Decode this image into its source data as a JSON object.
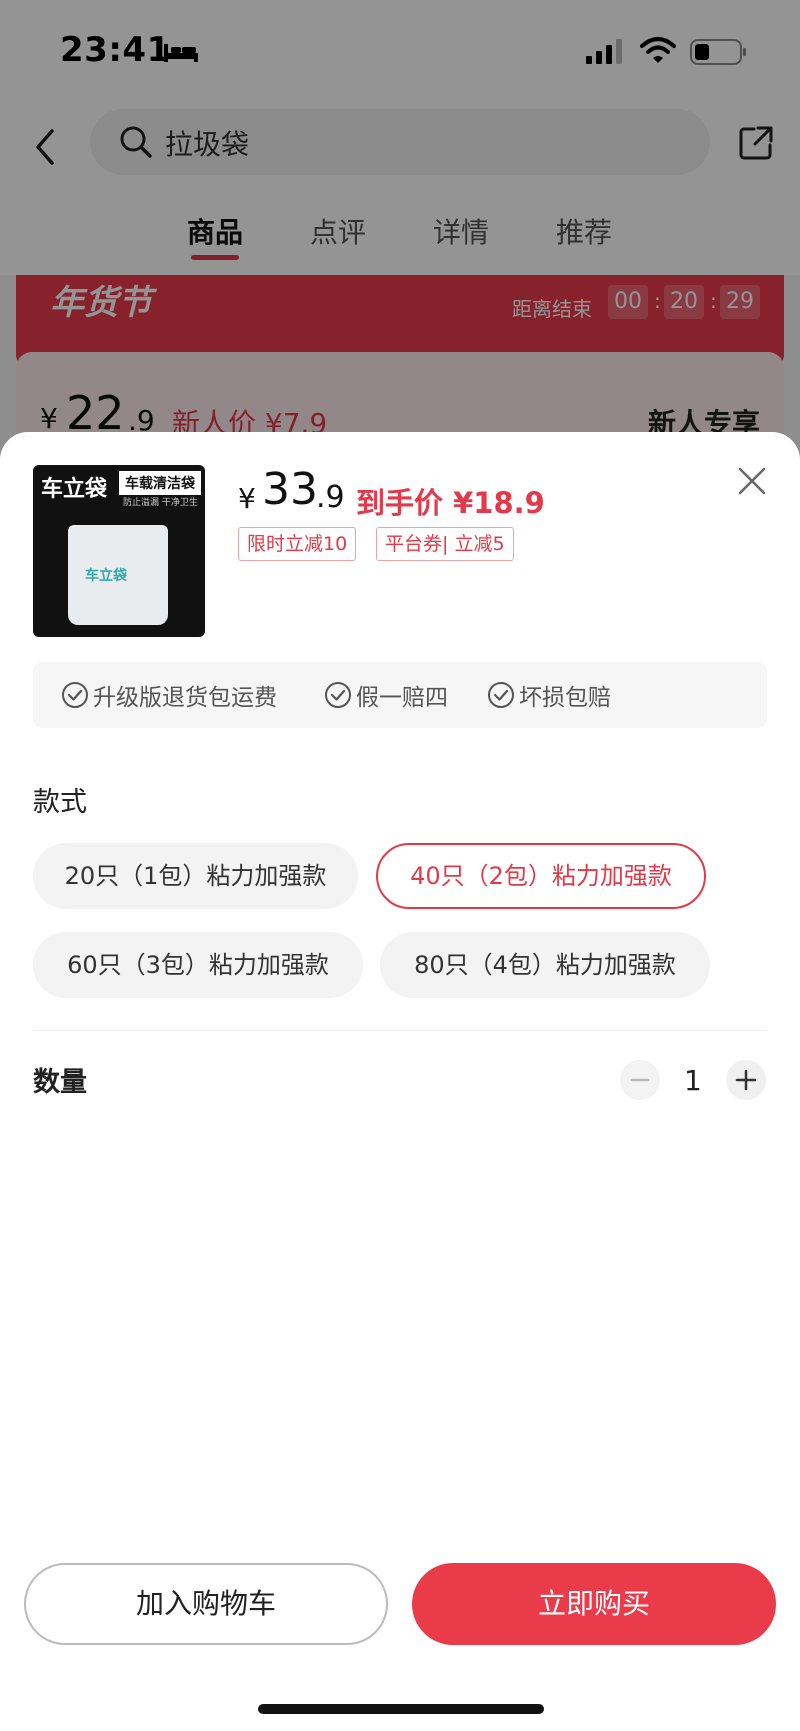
{
  "status_bar": {
    "time": "23:41"
  },
  "search": {
    "query": "拉圾袋"
  },
  "tabs": [
    {
      "label": "商品"
    },
    {
      "label": "点评"
    },
    {
      "label": "详情"
    },
    {
      "label": "推荐"
    }
  ],
  "promo": {
    "title": "年货节",
    "countdown_label": "距离结束",
    "countdown": [
      "00",
      "20",
      "29"
    ]
  },
  "background_price": {
    "symbol": "¥",
    "integer": "22",
    "decimal": ".9",
    "new_user_price": "新人价 ¥7.9",
    "exclusive": "新人专享"
  },
  "product": {
    "thumb_brand": "车立袋",
    "thumb_label": "车载清洁袋",
    "thumb_sub": "防止溢漏  干净卫生",
    "thumb_bag_text": "车立袋",
    "price_symbol": "¥",
    "price_integer": "33",
    "price_decimal": ".9",
    "final_price": "到手价 ¥18.9",
    "tags": [
      "限时立减10",
      "平台券| 立减5"
    ]
  },
  "guarantees": [
    "升级版退货包运费",
    "假一赔四",
    "坏损包赔"
  ],
  "style_section": {
    "label": "款式",
    "options": [
      "20只（1包）粘力加强款",
      "40只（2包）粘力加强款",
      "60只（3包）粘力加强款",
      "80只（4包）粘力加强款"
    ],
    "selected": "40只（2包）粘力加强款"
  },
  "quantity_section": {
    "label": "数量",
    "value": "1"
  },
  "actions": {
    "add_to_cart": "加入购物车",
    "buy_now": "立即购买"
  },
  "colors": {
    "accent": "#e23a4a",
    "buy_button": "#ea3b4b"
  }
}
